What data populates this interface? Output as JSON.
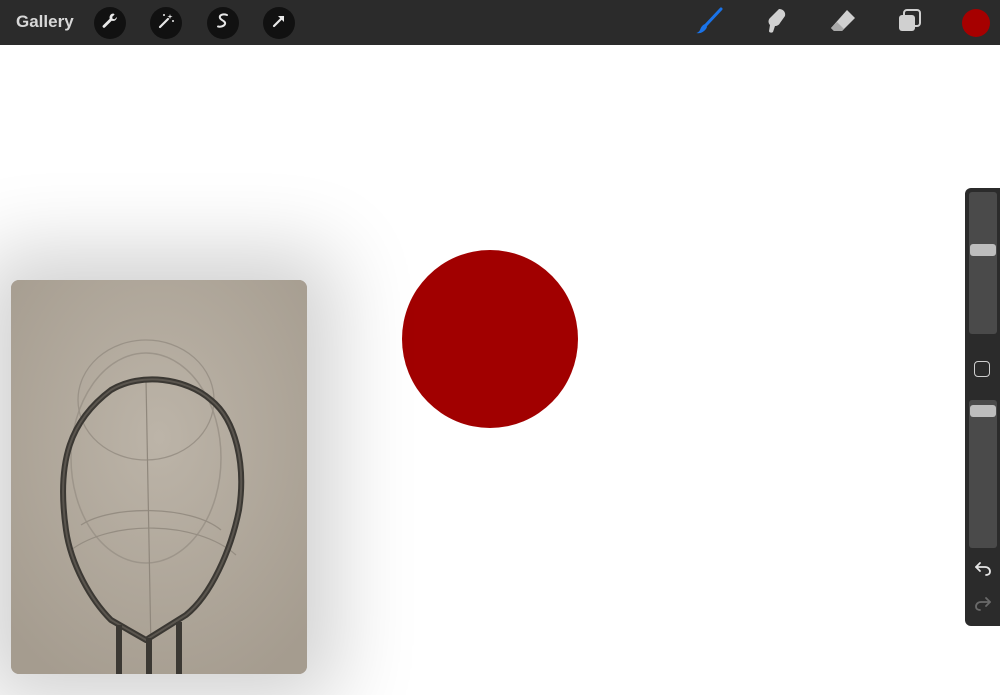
{
  "topbar": {
    "gallery_label": "Gallery",
    "left_tools": [
      "wrench-icon",
      "magic-wand-icon",
      "selection-icon",
      "transform-arrow-icon"
    ],
    "right_tools": [
      "brush-icon",
      "smudge-icon",
      "eraser-icon",
      "layers-icon"
    ],
    "active_tool": "brush-icon",
    "active_tool_color": "#1a73e8",
    "current_color": "#a60000"
  },
  "canvas": {
    "shape_color": "#a10000",
    "reference_image": "pencil-sketch-head"
  },
  "sidebar": {
    "brush_size": 0.6,
    "brush_opacity": 0.96,
    "icons": [
      "modify-square-icon",
      "undo-icon",
      "redo-icon"
    ]
  }
}
